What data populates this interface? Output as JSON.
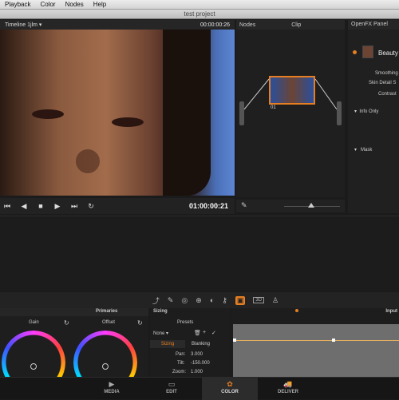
{
  "menubar": {
    "items": [
      "Playback",
      "Color",
      "Nodes",
      "Help"
    ]
  },
  "window": {
    "title": "test project"
  },
  "viewer": {
    "timeline": "Timeline 1jlm",
    "source_timecode": "00:00:00:26",
    "timecode": "01:00:00:21"
  },
  "nodes": {
    "title": "Nodes",
    "clip": "Clip",
    "node_label": "01"
  },
  "ofx": {
    "title": "OpenFX Panel",
    "plugin": "Beauty",
    "params": [
      "Smoothing",
      "Skin Detail S",
      "Contrast"
    ],
    "sections": [
      "Info Only",
      "Mask"
    ]
  },
  "primaries": {
    "title": "Primaries",
    "gain_label": "Gain",
    "offset_label": "Offset"
  },
  "sizing": {
    "title": "Sizing",
    "presets_label": "Presets",
    "preset_value": "None",
    "tabs": [
      "Sizing",
      "Blanking"
    ],
    "pan_label": "Pan:",
    "pan_value": "3.000",
    "tilt_label": "Tilt:",
    "tilt_value": "-150.000",
    "zoom_label": "Zoom:",
    "zoom_value": "1.000"
  },
  "keyframes": {
    "title": "Input"
  },
  "pages": [
    {
      "label": "MEDIA",
      "icon": "media-icon"
    },
    {
      "label": "EDIT",
      "icon": "edit-icon"
    },
    {
      "label": "COLOR",
      "icon": "color-icon"
    },
    {
      "label": "DELIVER",
      "icon": "deliver-icon"
    }
  ],
  "colors": {
    "accent": "#e67e22",
    "panel": "#1e1e1e"
  }
}
